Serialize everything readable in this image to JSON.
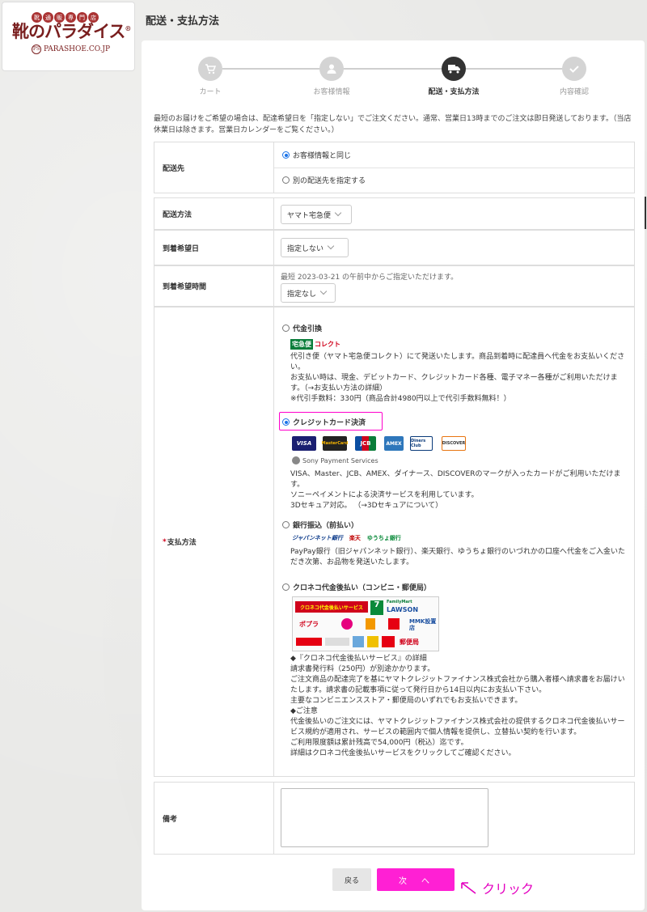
{
  "logo": {
    "badge_chars": [
      "靴",
      "通",
      "販",
      "専",
      "門",
      "店"
    ],
    "name": "靴のパラダイス",
    "mark": "®",
    "monogram": "PS",
    "domain": "PARASHOE.CO.JP"
  },
  "page_title": "配送・支払方法",
  "steps": [
    {
      "label": "カート",
      "icon": "cart-icon",
      "active": false
    },
    {
      "label": "お客様情報",
      "icon": "user-icon",
      "active": false
    },
    {
      "label": "配送・支払方法",
      "icon": "truck-icon",
      "active": true
    },
    {
      "label": "内容確認",
      "icon": "check-icon",
      "active": false
    }
  ],
  "intro": "最短のお届けをご希望の場合は、配達希望日を「指定しない」でご注文ください。通常、営業日13時までのご注文は即日発送しております。（当店休業日は除きます。営業日カレンダーをご覧ください。）",
  "shipping_dest": {
    "label": "配送先",
    "options": [
      "お客様情報と同じ",
      "別の配送先を指定する"
    ],
    "selected": 0
  },
  "shipping_method": {
    "label": "配送方法",
    "value": "ヤマト宅急便"
  },
  "delivery_date": {
    "label": "到着希望日",
    "value": "指定しない"
  },
  "delivery_time": {
    "label": "到着希望時間",
    "note": "最短 2023-03-21 の午前中からご指定いただけます。",
    "value": "指定なし"
  },
  "payment": {
    "required_mark": "*",
    "label": "支払方法",
    "cod": {
      "title": "代金引換",
      "logo_a": "宅急便",
      "logo_b": "コレクト",
      "lines": [
        "代引き便（ヤマト宅急便コレクト）にて発送いたします。商品到着時に配達員へ代金をお支払いください。",
        "お支払い時は、現金、デビットカード、クレジットカード各種、電子マネー各種がご利用いただけます。（→お支払い方法の詳細）",
        "※代引手数料：330円（商品合計4980円以上で代引手数料無料！）"
      ]
    },
    "credit": {
      "title": "クレジットカード決済",
      "cards": [
        "VISA",
        "MasterCard",
        "JCB",
        "AMEX",
        "Diners Club",
        "DISCOVER"
      ],
      "provider": "Sony Payment Services",
      "lines": [
        "VISA、Master、JCB、AMEX、ダイナース、DISCOVERのマークが入ったカードがご利用いただけます。",
        "ソニーペイメントによる決済サービスを利用しています。",
        "3Dセキュア対応。 （→3Dセキュアについて）"
      ]
    },
    "bank": {
      "title": "銀行振込（前払い）",
      "banks": [
        "ジャパンネット銀行",
        "楽天",
        "ゆうちょ銀行"
      ],
      "lines": [
        "PayPay銀行（旧ジャパンネット銀行）、楽天銀行、ゆうちょ銀行のいづれかの口座へ代金をご入金いただき次第、お品物を発送いたします。"
      ]
    },
    "kuroneko": {
      "title": "クロネコ代金後払い（コンビニ・郵便局）",
      "banner": "クロネコ代金後払いサービス",
      "stores": [
        "FamilyMart",
        "LAWSON",
        "ポプラ",
        "MMK設置店",
        "郵便局"
      ],
      "lines": [
        "◆『クロネコ代金後払いサービス』の詳細",
        "請求書発行料（250円）が別途かかります。",
        "ご注文商品の配達完了を基にヤマトクレジットファイナンス株式会社から購入者様へ請求書をお届けいたします。請求書の記載事項に従って発行日から14日以内にお支払い下さい。",
        "主要なコンビニエンスストア・郵便局のいずれでもお支払いできます。",
        "◆ご注意",
        "代金後払いのご注文には、ヤマトクレジットファイナンス株式会社の提供するクロネコ代金後払いサービス規約が適用され、サービスの範囲内で個人情報を提供し、立替払い契約を行います。",
        "ご利用限度額は累計残高で54,000円（税込）迄です。",
        "詳細はクロネコ代金後払いサービスをクリックしてご確認ください。"
      ]
    },
    "selected": 1
  },
  "remarks": {
    "label": "備考"
  },
  "buttons": {
    "back": "戻る",
    "next": "次　へ"
  },
  "annotation": {
    "text": "クリック",
    "color": "#e400c0"
  },
  "colors": {
    "accent": "#ff20d4",
    "radio": "#1a73e8",
    "active_step": "#333333"
  }
}
